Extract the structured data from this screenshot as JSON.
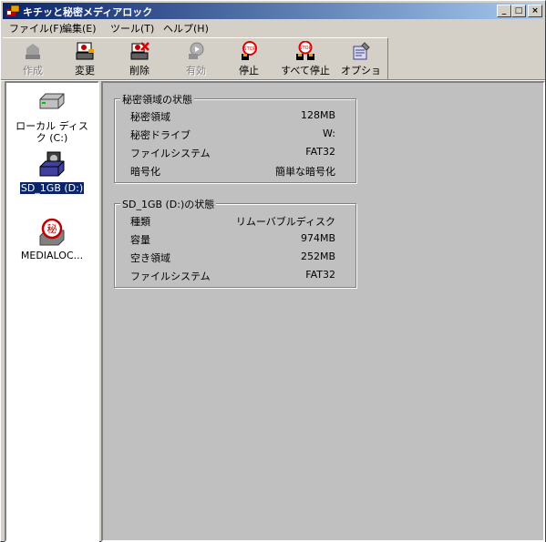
{
  "window": {
    "title": "キチッと秘密メディアロック"
  },
  "title_buttons": {
    "minimize": "_",
    "maximize": "□",
    "close": "×"
  },
  "menu": {
    "items": [
      {
        "label": "ファイル(F)"
      },
      {
        "label": "編集(E)"
      },
      {
        "label": "ツール(T)"
      },
      {
        "label": "ヘルプ(H)"
      }
    ]
  },
  "toolbar": {
    "items": [
      {
        "label": "作成",
        "icon": "create-icon",
        "enabled": false
      },
      {
        "label": "変更",
        "icon": "change-icon",
        "enabled": true
      },
      {
        "label": "削除",
        "icon": "delete-icon",
        "enabled": true
      },
      {
        "label": "有効",
        "icon": "enable-icon",
        "enabled": false
      },
      {
        "label": "停止",
        "icon": "stop-icon",
        "enabled": true
      },
      {
        "label": "すべて停止",
        "icon": "stop-all-icon",
        "enabled": true
      },
      {
        "label": "オプション",
        "icon": "options-icon",
        "enabled": true
      }
    ]
  },
  "drives": [
    {
      "label": "ローカル ディスク (C:)",
      "icon": "hard-drive-icon",
      "selected": false
    },
    {
      "label": "SD_1GB (D:)",
      "icon": "removable-disk-icon",
      "selected": true
    },
    {
      "label": "MEDIALOC...",
      "icon": "secret-media-icon",
      "selected": false
    }
  ],
  "secret_area": {
    "title": "秘密領域の状態",
    "rows": [
      {
        "key": "秘密領域",
        "value": "128MB"
      },
      {
        "key": "秘密ドライブ",
        "value": "W:"
      },
      {
        "key": "ファイルシステム",
        "value": "FAT32"
      },
      {
        "key": "暗号化",
        "value": "簡単な暗号化"
      }
    ]
  },
  "drive_status": {
    "title": "SD_1GB (D:)の状態",
    "rows": [
      {
        "key": "種類",
        "value": "リムーバブルディスク"
      },
      {
        "key": "容量",
        "value": "974MB"
      },
      {
        "key": "空き領域",
        "value": "252MB"
      },
      {
        "key": "ファイルシステム",
        "value": "FAT32"
      }
    ]
  },
  "colors": {
    "titlebar": "#0a246a",
    "selection": "#0a246a",
    "face": "#d4d0c8"
  }
}
